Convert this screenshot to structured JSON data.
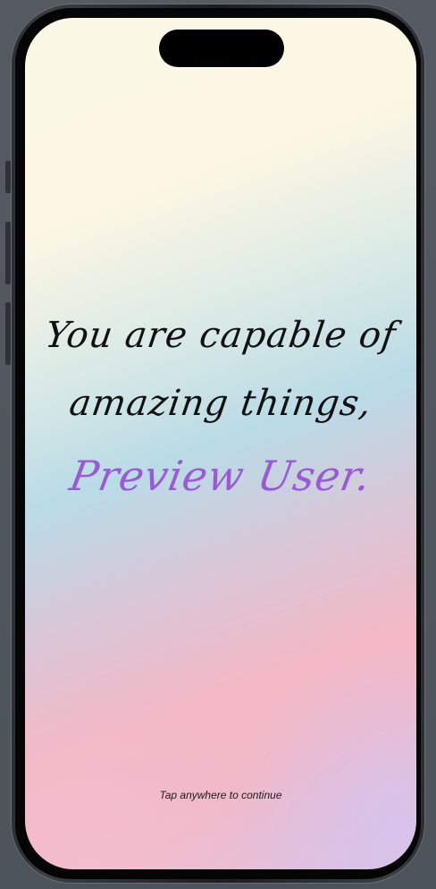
{
  "screen": {
    "quote_line_1": "You are capable of",
    "quote_line_2": "amazing things,",
    "user_name": "Preview User.",
    "hint": "Tap anywhere to continue"
  },
  "colors": {
    "name_accent": "#9a5ad8",
    "text": "#111111",
    "gradient_top": "#fcf7e4",
    "gradient_middle": "#b9dbe6",
    "gradient_bottom": "#f2b8c5"
  }
}
